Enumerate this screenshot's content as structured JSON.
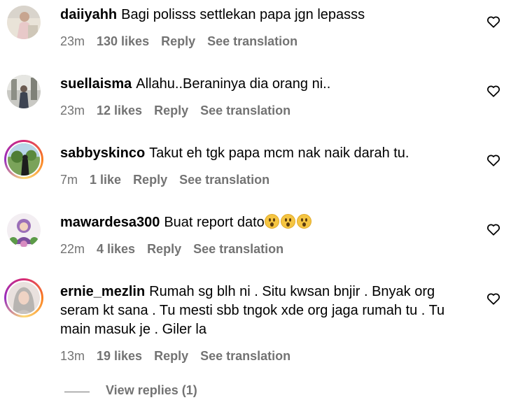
{
  "comments": [
    {
      "username": "daiiyahh",
      "text": "Bagi polisss settlekan papa jgn lepasss",
      "time": "23m",
      "likes": "130 likes",
      "reply": "Reply",
      "translate": "See translation"
    },
    {
      "username": "suellaisma",
      "text": "Allahu..Beraninya dia orang ni..",
      "time": "23m",
      "likes": "12 likes",
      "reply": "Reply",
      "translate": "See translation"
    },
    {
      "username": "sabbyskinco",
      "text": "Takut eh tgk papa mcm nak naik darah tu.",
      "time": "7m",
      "likes": "1 like",
      "reply": "Reply",
      "translate": "See translation"
    },
    {
      "username": "mawardesa300",
      "text": "Buat report dato",
      "time": "22m",
      "likes": "4 likes",
      "reply": "Reply",
      "translate": "See translation"
    },
    {
      "username": "ernie_mezlin",
      "text": "Rumah sg blh ni . Situ kwsan bnjir . Bnyak org seram kt sana . Tu mesti sbb tngok xde org jaga rumah tu . Tu main masuk je . Giler la",
      "time": "13m",
      "likes": "19 likes",
      "reply": "Reply",
      "translate": "See translation"
    }
  ],
  "view_replies": "View replies (1)",
  "icons": {
    "like": "heart-icon",
    "emoji": "astonished-face-emoji"
  }
}
